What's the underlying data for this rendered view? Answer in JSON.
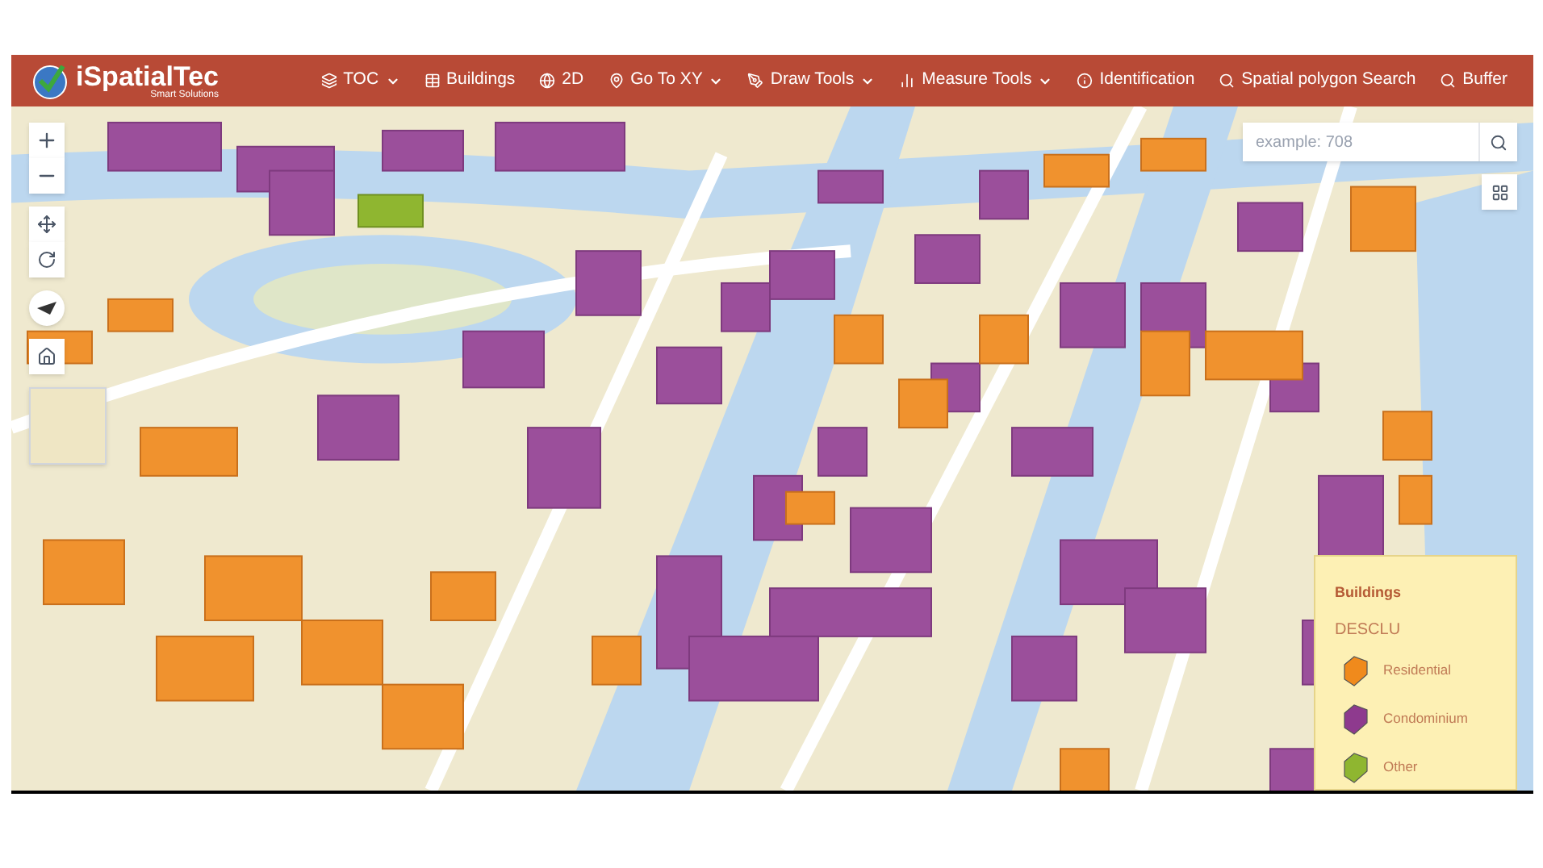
{
  "brand": {
    "name": "iSpatialTec",
    "tagline": "Smart Solutions"
  },
  "nav": [
    {
      "label": "TOC",
      "dropdown": true
    },
    {
      "label": "Buildings",
      "dropdown": false
    },
    {
      "label": "2D",
      "dropdown": false
    },
    {
      "label": "Go To XY",
      "dropdown": true
    },
    {
      "label": "Draw Tools",
      "dropdown": true
    },
    {
      "label": "Measure Tools",
      "dropdown": true
    },
    {
      "label": "Identification",
      "dropdown": false
    },
    {
      "label": "Spatial polygon Search",
      "dropdown": false
    },
    {
      "label": "Buffer",
      "dropdown": false
    }
  ],
  "search": {
    "placeholder": "example: 708"
  },
  "legend": {
    "title": "Buildings",
    "field": "DESCLU",
    "items": [
      {
        "label": "Residential",
        "color": "#f08a1c"
      },
      {
        "label": "Condominium",
        "color": "#8e3a8e"
      },
      {
        "label": "Other",
        "color": "#8fb630"
      }
    ]
  }
}
